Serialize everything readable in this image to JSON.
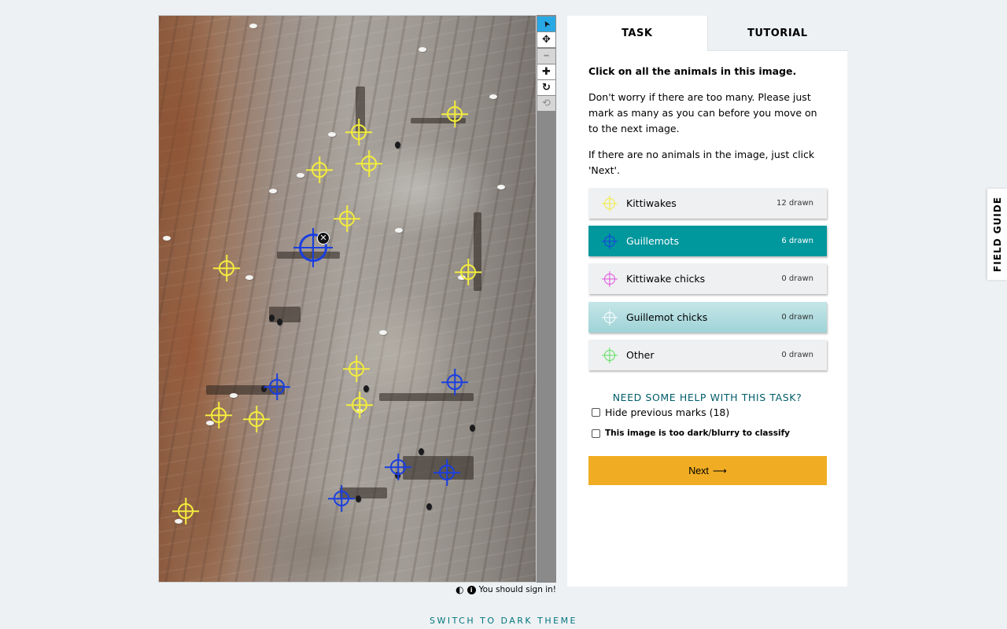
{
  "toolbar": {
    "tools": [
      {
        "name": "pointer",
        "glyph": "➤"
      },
      {
        "name": "pan",
        "glyph": "✥"
      },
      {
        "name": "zoom-out",
        "glyph": "━"
      },
      {
        "name": "zoom-in",
        "glyph": "✚"
      },
      {
        "name": "rotate",
        "glyph": "↻"
      },
      {
        "name": "reset",
        "glyph": "⟲"
      }
    ]
  },
  "status": {
    "sign_in": "You should sign in!"
  },
  "tabs": {
    "task": "TASK",
    "tutorial": "TUTORIAL"
  },
  "task": {
    "question": "Click on all the animals in this image.",
    "instruction_1": "Don't worry if there are too many. Please just mark as many as you can before you move on to the next image.",
    "instruction_2": "If there are no animals in the image, just click 'Next'.",
    "choices": [
      {
        "label": "Kittiwakes",
        "count": "12 drawn",
        "icon_color": "#f3ec3e"
      },
      {
        "label": "Guillemots",
        "count": "6 drawn",
        "icon_color": "#1a3fe0"
      },
      {
        "label": "Kittiwake chicks",
        "count": "0 drawn",
        "icon_color": "#e050e0"
      },
      {
        "label": "Guillemot chicks",
        "count": "0 drawn",
        "icon_color": "#ffffff"
      },
      {
        "label": "Other",
        "count": "0 drawn",
        "icon_color": "#5ee05e"
      }
    ],
    "help_link": "NEED SOME HELP WITH THIS TASK?",
    "hide_marks": "Hide previous marks (18)",
    "too_dark": "This image is too dark/blurry to classify",
    "next_label": "Next",
    "next_arrow": "⟶"
  },
  "field_guide": "FIELD GUIDE",
  "theme_switch": "SWITCH TO DARK THEME",
  "colors": {
    "selected": "#00979d",
    "next_button": "#f0ad23",
    "active_tool": "#29a8e6"
  }
}
